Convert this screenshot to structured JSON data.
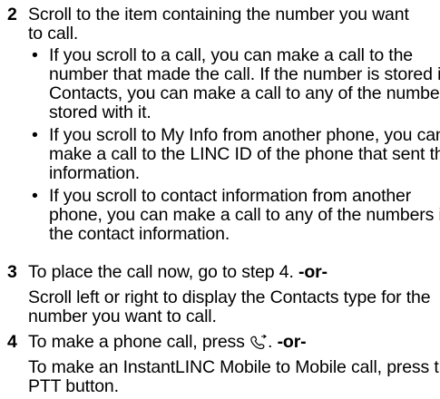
{
  "steps": [
    {
      "number": "2",
      "text": "Scroll to the item containing the number you want to call.",
      "bullets": [
        "If you scroll to a call, you can make a call to the number that made the call. If the number is stored in Contacts, you can make a call to any of the numbers stored with it.",
        "If you scroll to My Info from another phone, you can make a call to the LINC ID of the phone that sent the information.",
        "If you scroll to contact information from another phone, you can make a call to any of the numbers in the contact information."
      ]
    },
    {
      "number": "3",
      "text": "To place the call now, go to step 4.",
      "or_label": "-or-",
      "sub_text": "Scroll left or right to display the Contacts type for the number you want to call."
    },
    {
      "number": "4",
      "text_before_icon": "To make a phone call, press",
      "icon": "send-call-key-icon",
      "text_after_icon": ".",
      "or_label": "-or-",
      "sub_text": "To make an InstantLINC Mobile to Mobile call, press the PTT button."
    }
  ],
  "bullet_glyph": "•"
}
